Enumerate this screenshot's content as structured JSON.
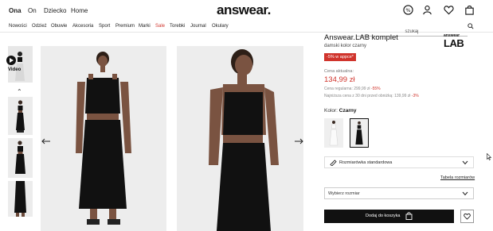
{
  "header": {
    "genders": [
      "Ona",
      "On",
      "Dziecko",
      "Home"
    ],
    "active_gender": "Ona",
    "logo": "answear."
  },
  "categories": [
    "Nowości",
    "Odzież",
    "Obuwie",
    "Akcesoria",
    "Sport",
    "Premium",
    "Marki",
    "Sale",
    "Torebki",
    "Journal",
    "Okulary"
  ],
  "search": {
    "placeholder": "szukaj"
  },
  "gallery": {
    "video_label": "Video"
  },
  "product": {
    "brand_logo": "LAB",
    "brand_logo_top": "answear",
    "title": "Answear.LAB komplet",
    "subtitle": "damski kolor czarny",
    "promo_badge": "-5% w appce*",
    "current_label": "Cena aktualna:",
    "price": "134,99 zł",
    "regular_label": "Cena regularna: 299,99 zł",
    "regular_pct": "-55%",
    "lowest_label": "Najniższa cena z 30 dni przed obniżką: 139,99 zł",
    "lowest_pct": "-3%",
    "color_label": "Kolor:",
    "color_value": "Czarny",
    "size_chart_label": "Rozmiarówka standardowa",
    "size_table_link": "Tabela rozmiarów",
    "size_select": "Wybierz rozmiar",
    "add_to_cart": "Dodaj do koszyka"
  },
  "colors": {
    "sale": "#d0342c",
    "primary": "#111111"
  }
}
